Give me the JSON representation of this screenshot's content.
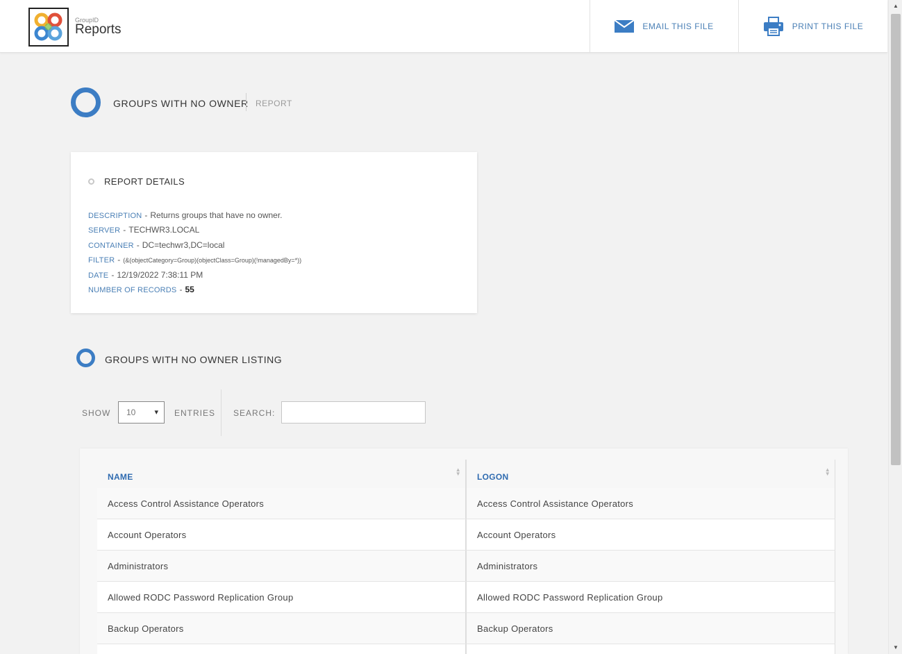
{
  "header": {
    "brand_small": "GroupID",
    "brand_big": "Reports",
    "email_label": "EMAIL THIS FILE",
    "print_label": "PRINT THIS FILE"
  },
  "page": {
    "title": "GROUPS WITH NO OWNER",
    "subtitle": "REPORT"
  },
  "details": {
    "title": "REPORT DETAILS",
    "items": [
      {
        "key": "DESCRIPTION",
        "value": "Returns groups that have no owner."
      },
      {
        "key": "SERVER",
        "value": "TECHWR3.LOCAL"
      },
      {
        "key": "CONTAINER",
        "value": "DC=techwr3,DC=local"
      },
      {
        "key": "FILTER",
        "value": "(&(objectCategory=Group)(objectClass=Group)(!managedBy=*))"
      },
      {
        "key": "DATE",
        "value": "12/19/2022 7:38:11 PM"
      },
      {
        "key": "NUMBER OF RECORDS",
        "value": "55"
      }
    ]
  },
  "listing": {
    "title": "GROUPS WITH NO OWNER LISTING",
    "show_label": "SHOW",
    "show_value": "10",
    "entries_label": "ENTRIES",
    "search_label": "SEARCH:",
    "search_value": ""
  },
  "table": {
    "columns": [
      "NAME",
      "LOGON"
    ],
    "rows": [
      [
        "Access Control Assistance Operators",
        "Access Control Assistance Operators"
      ],
      [
        "Account Operators",
        "Account Operators"
      ],
      [
        "Administrators",
        "Administrators"
      ],
      [
        "Allowed RODC Password Replication Group",
        "Allowed RODC Password Replication Group"
      ],
      [
        "Backup Operators",
        "Backup Operators"
      ],
      [
        "",
        ""
      ]
    ]
  },
  "colors": {
    "accent": "#3c7dc4",
    "link": "#4a7fb5"
  },
  "icons": {
    "email": "envelope-icon",
    "print": "printer-icon",
    "sort": "sort-icon",
    "select": "chevron-down-icon"
  }
}
